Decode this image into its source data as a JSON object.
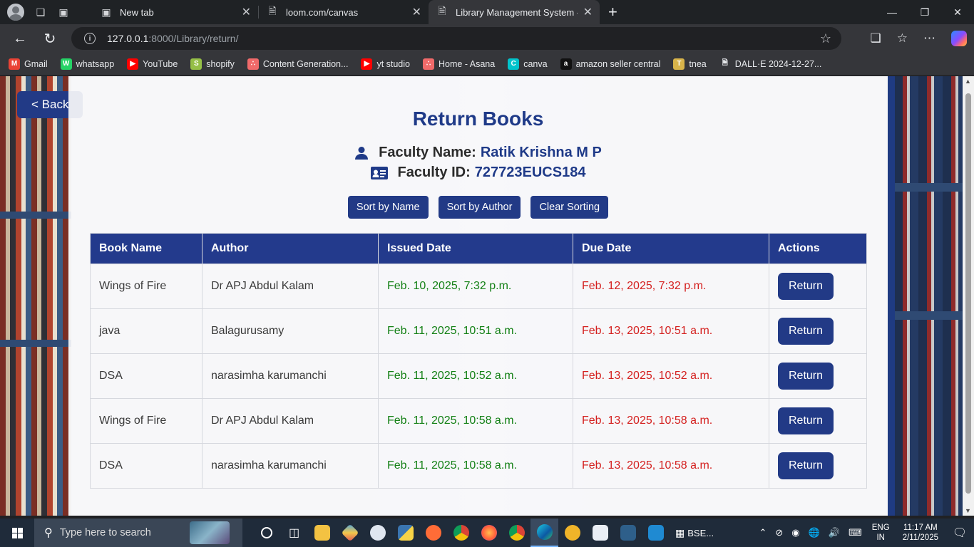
{
  "browser": {
    "tabs": [
      {
        "title": "New tab"
      },
      {
        "title": "loom.com/canvas"
      },
      {
        "title": "Library Management System - Ret"
      }
    ],
    "url_host": "127.0.0.1",
    "url_rest": ":8000/Library/return/",
    "bookmarks": [
      {
        "label": "Gmail",
        "icon": "gmail-icon",
        "color": "#ea4335"
      },
      {
        "label": "whatsapp",
        "icon": "whatsapp-icon",
        "color": "#25d366"
      },
      {
        "label": "YouTube",
        "icon": "youtube-icon",
        "color": "#ff0000"
      },
      {
        "label": "shopify",
        "icon": "shopify-icon",
        "color": "#95bf47"
      },
      {
        "label": "Content Generation...",
        "icon": "asana-icon",
        "color": "#f06a6a"
      },
      {
        "label": "yt studio",
        "icon": "youtube-icon",
        "color": "#ff0000"
      },
      {
        "label": "Home - Asana",
        "icon": "asana-icon",
        "color": "#f06a6a"
      },
      {
        "label": "canva",
        "icon": "canva-icon",
        "color": "#00c4cc"
      },
      {
        "label": "amazon seller central",
        "icon": "amazon-icon",
        "color": "#111111"
      },
      {
        "label": "tnea",
        "icon": "tnea-icon",
        "color": "#d8b44a"
      },
      {
        "label": "DALL·E 2024-12-27...",
        "icon": "file-icon",
        "color": "#e8eaed"
      }
    ]
  },
  "page": {
    "back_label": "< Back",
    "title": "Return Books",
    "faculty_name_label": "Faculty Name:",
    "faculty_name": "Ratik Krishna M P",
    "faculty_id_label": "Faculty ID:",
    "faculty_id": "727723EUCS184",
    "sort_buttons": [
      "Sort by Name",
      "Sort by Author",
      "Clear Sorting"
    ],
    "columns": [
      "Book Name",
      "Author",
      "Issued Date",
      "Due Date",
      "Actions"
    ],
    "return_label": "Return",
    "rows": [
      {
        "book": "Wings of Fire",
        "author": "Dr APJ Abdul Kalam",
        "issued": "Feb. 10, 2025, 7:32 p.m.",
        "due": "Feb. 12, 2025, 7:32 p.m."
      },
      {
        "book": "java",
        "author": "Balagurusamy",
        "issued": "Feb. 11, 2025, 10:51 a.m.",
        "due": "Feb. 13, 2025, 10:51 a.m."
      },
      {
        "book": "DSA",
        "author": "narasimha karumanchi",
        "issued": "Feb. 11, 2025, 10:52 a.m.",
        "due": "Feb. 13, 2025, 10:52 a.m."
      },
      {
        "book": "Wings of Fire",
        "author": "Dr APJ Abdul Kalam",
        "issued": "Feb. 11, 2025, 10:58 a.m.",
        "due": "Feb. 13, 2025, 10:58 a.m."
      },
      {
        "book": "DSA",
        "author": "narasimha karumanchi",
        "issued": "Feb. 11, 2025, 10:58 a.m.",
        "due": "Feb. 13, 2025, 10:58 a.m."
      }
    ]
  },
  "taskbar": {
    "search_placeholder": "Type here to search",
    "app_label": "BSE...",
    "lang_line1": "ENG",
    "lang_line2": "IN",
    "time": "11:17 AM",
    "date": "2/11/2025"
  },
  "colors": {
    "primary": "#223a86",
    "issued": "#138015",
    "due": "#d4201f"
  }
}
